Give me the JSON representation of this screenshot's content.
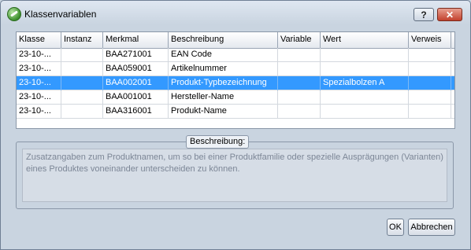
{
  "window": {
    "title": "Klassenvariablen",
    "help_label": "?",
    "close_label": "✕"
  },
  "table": {
    "columns": [
      "Klasse",
      "Instanz",
      "Merkmal",
      "Beschreibung",
      "Variable",
      "Wert",
      "Verweis"
    ],
    "rows": [
      {
        "klasse": "23-10-...",
        "instanz": "",
        "merkmal": "BAA271001",
        "beschreibung": "EAN Code",
        "variable": "",
        "wert": "",
        "verweis": "",
        "selected": false
      },
      {
        "klasse": "23-10-...",
        "instanz": "",
        "merkmal": "BAA059001",
        "beschreibung": "Artikelnummer",
        "variable": "",
        "wert": "",
        "verweis": "",
        "selected": false
      },
      {
        "klasse": "23-10-...",
        "instanz": "",
        "merkmal": "BAA002001",
        "beschreibung": "Produkt-Typbezeichnung",
        "variable": "",
        "wert": "Spezialbolzen A",
        "verweis": "",
        "selected": true
      },
      {
        "klasse": "23-10-...",
        "instanz": "",
        "merkmal": "BAA001001",
        "beschreibung": "Hersteller-Name",
        "variable": "",
        "wert": "",
        "verweis": "",
        "selected": false
      },
      {
        "klasse": "23-10-...",
        "instanz": "",
        "merkmal": "BAA316001",
        "beschreibung": "Produkt-Name",
        "variable": "",
        "wert": "",
        "verweis": "",
        "selected": false
      }
    ]
  },
  "description": {
    "caption": "Beschreibung:",
    "text": "Zusatzangaben zum Produktnamen, um so bei einer Produktfamilie oder spezielle Ausprägungen (Varianten) eines Produktes voneinander unterscheiden zu können."
  },
  "buttons": {
    "ok_label": "OK",
    "cancel_label": "Abbrechen"
  },
  "colors": {
    "selection": "#3399ff",
    "close_button": "#c2402c"
  }
}
